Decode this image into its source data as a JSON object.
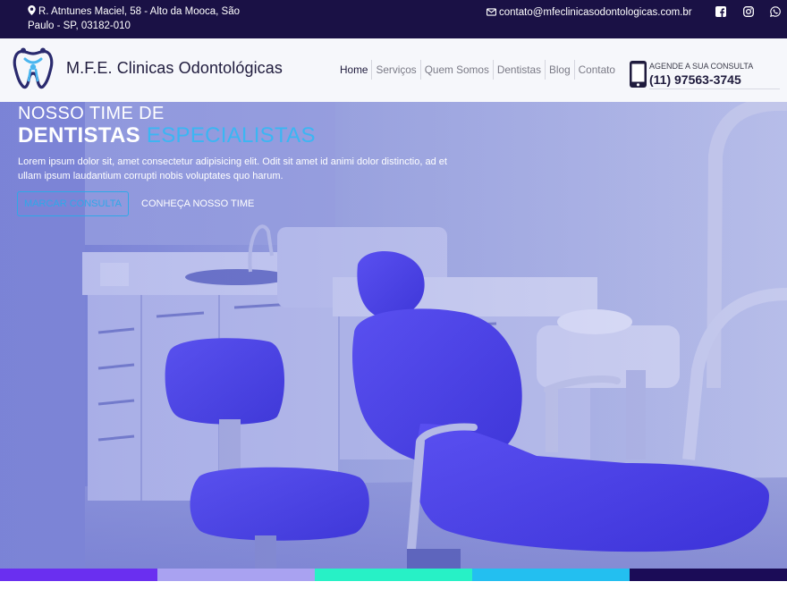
{
  "topbar": {
    "address": "R. Atntunes Maciel, 58 - Alto da Mooca, São Paulo - SP, 03182-010",
    "email": "contato@mfeclinicasodontologicas.com.br",
    "social": [
      "facebook-icon",
      "instagram-icon",
      "whatsapp-icon"
    ]
  },
  "header": {
    "brand": "M.F.E. Clinicas Odontológicas",
    "nav": [
      "Home",
      "Serviços",
      "Quem Somos",
      "Dentistas",
      "Blog",
      "Contato"
    ],
    "active_nav": "Home",
    "schedule_label": "AGENDE A SUA CONSULTA",
    "schedule_phone": "(11) 97563-3745"
  },
  "hero": {
    "title_line1": "NOSSO TIME DE",
    "title_word1": "DENTISTAS",
    "title_word2": "ESPECIALISTAS",
    "text": "Lorem ipsum dolor sit, amet consectetur adipisicing elit. Odit sit amet id animi dolor distinctio, ad et ullam ipsum laudantium corrupti nobis voluptates quo harum.",
    "button_primary": "MARCAR CONSULTA",
    "button_secondary": "CONHEÇA NOSSO TIME"
  },
  "colors": {
    "topbar_bg": "#1a1145",
    "accent_blue": "#3bb6f3",
    "hero_overlay": "#5560d8",
    "stripe": [
      "#6a2ff0",
      "#a9a2f1",
      "#27f1c6",
      "#23bff0",
      "#1b0c57"
    ]
  }
}
